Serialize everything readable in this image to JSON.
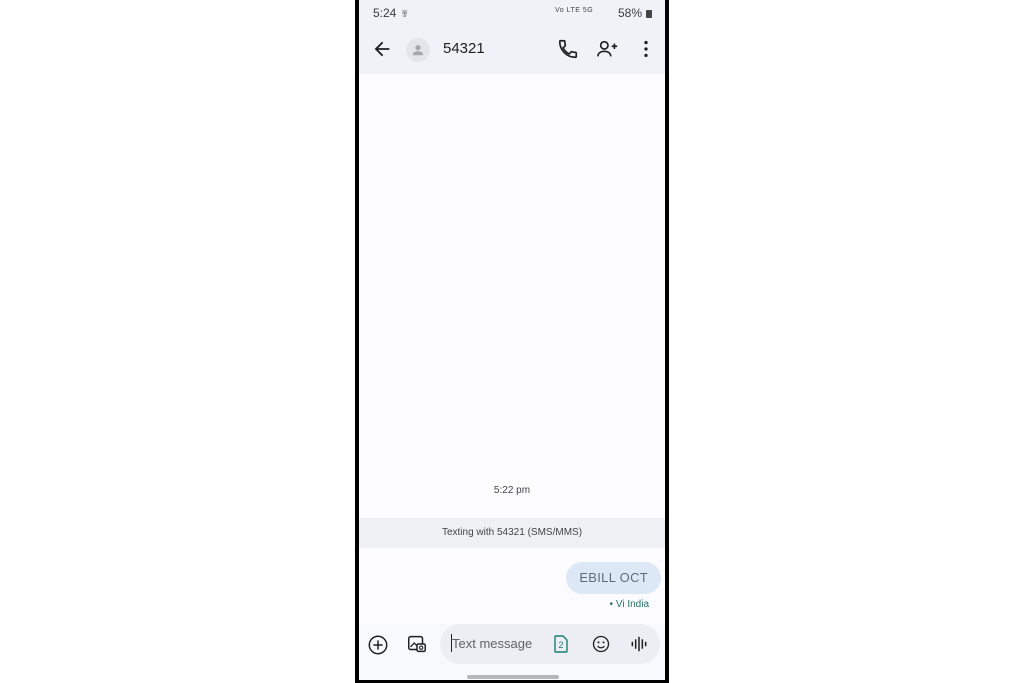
{
  "status_bar": {
    "time": "5:24",
    "carrier_icon_text": "कु",
    "network_text": "Vo LTE 5G",
    "battery": "58%"
  },
  "app_bar": {
    "title": "54321",
    "icons": [
      "back-arrow-icon",
      "avatar-icon",
      "phone-icon",
      "add-person-icon",
      "more-vert-icon"
    ]
  },
  "conversation": {
    "timestamp": "5:22 pm",
    "banner": "Texting with 54321 (SMS/MMS)",
    "messages": [
      {
        "text": "EBILL OCT",
        "direction": "outgoing",
        "via": "• Vi India"
      }
    ]
  },
  "composer": {
    "placeholder": "Text message",
    "sim_badge": "2",
    "icons": [
      "add-circle-icon",
      "gallery-icon",
      "sim-icon",
      "emoji-icon",
      "voice-icon"
    ]
  }
}
